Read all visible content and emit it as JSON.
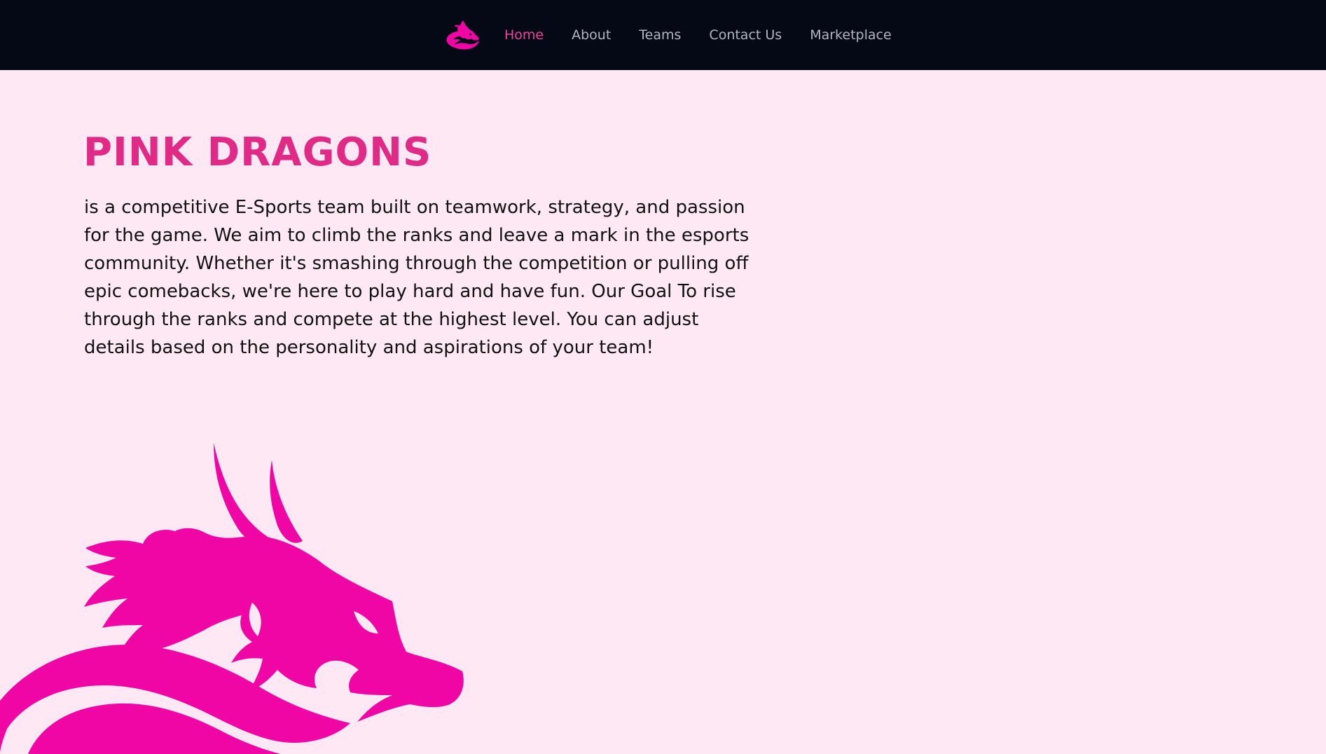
{
  "nav": {
    "logo_icon": "pink-dragon-logo-icon",
    "items": [
      {
        "label": "Home",
        "active": true
      },
      {
        "label": "About",
        "active": false
      },
      {
        "label": "Teams",
        "active": false
      },
      {
        "label": "Contact Us",
        "active": false
      },
      {
        "label": "Marketplace",
        "active": false
      }
    ],
    "background_color": "#050916",
    "active_color": "#e9459a",
    "inactive_color": "#b3b6c0"
  },
  "hero": {
    "title": "PINK DRAGONS",
    "description": "is a competitive E-Sports team built on teamwork, strategy, and passion for the game. We aim to climb the ranks and leave a mark in the esports community. Whether it's smashing through the competition or pulling off epic comebacks, we're here to play hard and have fun. Our Goal To rise through the ranks and compete at the highest level. You can adjust details based on the personality and aspirations of your team!",
    "title_color": "#e02a86",
    "art_icon": "pink-dragon-illustration-icon",
    "art_color": "#f006a4"
  },
  "page": {
    "background_color": "#fde8f3"
  }
}
